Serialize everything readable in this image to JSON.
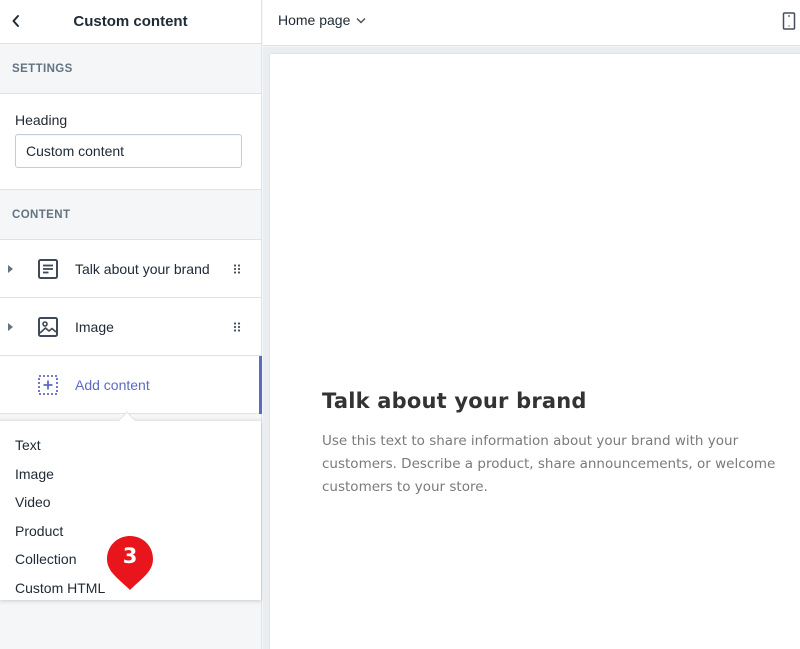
{
  "sidebar": {
    "title": "Custom content",
    "back_icon": "chevron-left-icon",
    "settings": {
      "section_label": "SETTINGS",
      "heading_label": "Heading",
      "heading_value": "Custom content"
    },
    "content": {
      "section_label": "CONTENT",
      "items": [
        {
          "label": "Talk about your brand",
          "icon": "text-block-icon"
        },
        {
          "label": "Image",
          "icon": "image-icon"
        }
      ],
      "add_label": "Add content",
      "add_icon": "add-block-icon"
    },
    "add_menu": {
      "options": [
        "Text",
        "Image",
        "Video",
        "Product",
        "Collection",
        "Custom HTML"
      ]
    }
  },
  "topbar": {
    "page_select": "Home page",
    "device_icon": "mobile-device-icon"
  },
  "preview": {
    "heading": "Talk about your brand",
    "body": "Use this text to share information about your brand with your customers. Describe a product, share announcements, or welcome customers to your store."
  },
  "annotation": {
    "step_number": "3",
    "color": "#e8161c"
  },
  "colors": {
    "accent": "#5c6ac4",
    "text": "#212b36",
    "muted": "#637381"
  }
}
